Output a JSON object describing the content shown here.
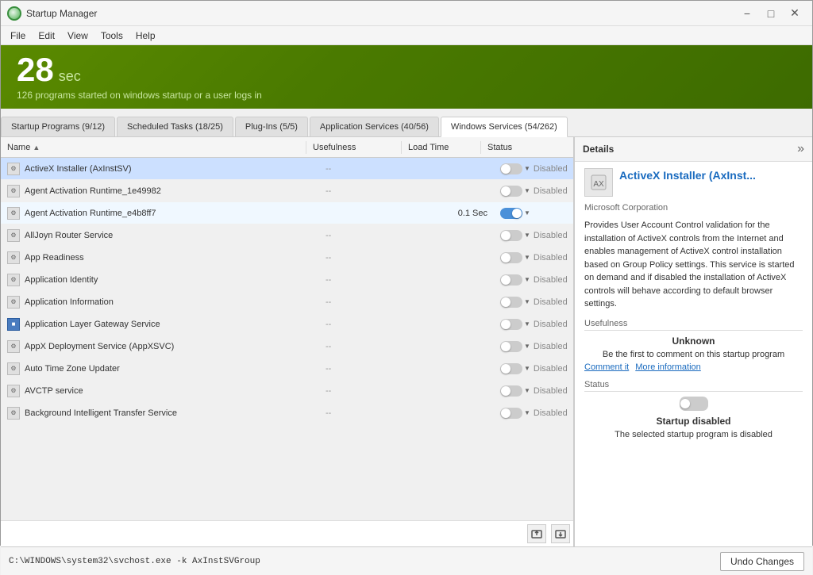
{
  "titleBar": {
    "title": "Startup Manager",
    "logoAlt": "Startup Manager Logo",
    "minBtn": "−",
    "maxBtn": "□",
    "closeBtn": "✕"
  },
  "menuBar": {
    "items": [
      "File",
      "Edit",
      "View",
      "Tools",
      "Help"
    ]
  },
  "header": {
    "number": "28",
    "unit": "sec",
    "subtitle": "126 programs started on windows startup or a user logs in"
  },
  "tabs": [
    {
      "label": "Startup Programs (9/12)",
      "active": false
    },
    {
      "label": "Scheduled Tasks (18/25)",
      "active": false
    },
    {
      "label": "Plug-Ins (5/5)",
      "active": false
    },
    {
      "label": "Application Services (40/56)",
      "active": false
    },
    {
      "label": "Windows Services (54/262)",
      "active": true
    }
  ],
  "tableColumns": {
    "name": "Name",
    "usefulness": "Usefulness",
    "loadTime": "Load Time",
    "status": "Status"
  },
  "tableRows": [
    {
      "name": "ActiveX Installer (AxInstSV)",
      "usefulness": "--",
      "loadTime": "",
      "status": "Disabled",
      "toggleOn": false,
      "selected": true,
      "iconBlue": false
    },
    {
      "name": "Agent Activation Runtime_1e49982",
      "usefulness": "--",
      "loadTime": "",
      "status": "Disabled",
      "toggleOn": false,
      "selected": false,
      "iconBlue": false
    },
    {
      "name": "Agent Activation Runtime_e4b8ff7",
      "usefulness": "",
      "loadTime": "0.1 Sec",
      "status": "",
      "toggleOn": true,
      "selected": false,
      "iconBlue": false,
      "enabled": true
    },
    {
      "name": "AllJoyn Router Service",
      "usefulness": "--",
      "loadTime": "",
      "status": "Disabled",
      "toggleOn": false,
      "selected": false,
      "iconBlue": false
    },
    {
      "name": "App Readiness",
      "usefulness": "--",
      "loadTime": "",
      "status": "Disabled",
      "toggleOn": false,
      "selected": false,
      "iconBlue": false
    },
    {
      "name": "Application Identity",
      "usefulness": "--",
      "loadTime": "",
      "status": "Disabled",
      "toggleOn": false,
      "selected": false,
      "iconBlue": false
    },
    {
      "name": "Application Information",
      "usefulness": "--",
      "loadTime": "",
      "status": "Disabled",
      "toggleOn": false,
      "selected": false,
      "iconBlue": false
    },
    {
      "name": "Application Layer Gateway Service",
      "usefulness": "--",
      "loadTime": "",
      "status": "Disabled",
      "toggleOn": false,
      "selected": false,
      "iconBlue": true
    },
    {
      "name": "AppX Deployment Service (AppXSVC)",
      "usefulness": "--",
      "loadTime": "",
      "status": "Disabled",
      "toggleOn": false,
      "selected": false,
      "iconBlue": false
    },
    {
      "name": "Auto Time Zone Updater",
      "usefulness": "--",
      "loadTime": "",
      "status": "Disabled",
      "toggleOn": false,
      "selected": false,
      "iconBlue": false
    },
    {
      "name": "AVCTP service",
      "usefulness": "--",
      "loadTime": "",
      "status": "Disabled",
      "toggleOn": false,
      "selected": false,
      "iconBlue": false
    },
    {
      "name": "Background Intelligent Transfer Service",
      "usefulness": "--",
      "loadTime": "",
      "status": "Disabled",
      "toggleOn": false,
      "selected": false,
      "iconBlue": false
    }
  ],
  "details": {
    "title": "Details",
    "expandIcon": "»",
    "appName": "ActiveX Installer (AxInst...",
    "company": "Microsoft Corporation",
    "description": "Provides User Account Control validation for the installation of ActiveX controls from the Internet and enables management of ActiveX control installation based on Group Policy settings. This service is started on demand and if disabled the installation of ActiveX controls will behave according to default browser settings.",
    "usefulnessTitle": "Usefulness",
    "usefulnessLabel": "Unknown",
    "usefulnessSub": "Be the first to comment on this startup program",
    "commentLink": "Comment it",
    "moreInfoLink": "More information",
    "statusTitle": "Status",
    "statusLabel": "Startup disabled",
    "statusSub": "The selected startup program is disabled"
  },
  "bottomBar": {
    "path": "C:\\WINDOWS\\system32\\svchost.exe -k AxInstSVGroup",
    "undoBtn": "Undo Changes"
  }
}
